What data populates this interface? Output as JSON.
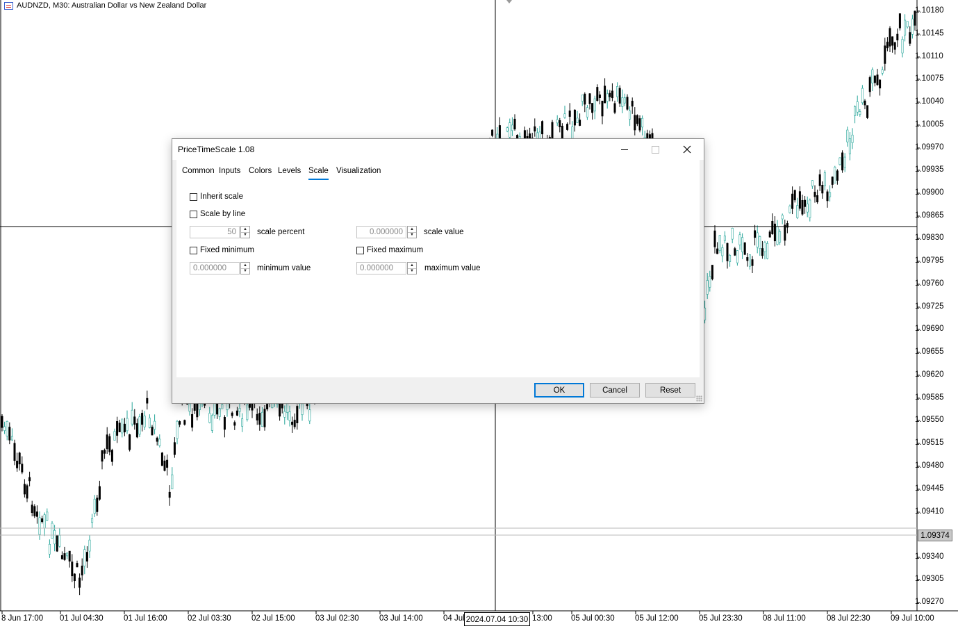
{
  "chart": {
    "title": "AUDNZD, M30:  Australian Dollar vs New Zealand Dollar",
    "price_labels": [
      "1.10180",
      "1.10145",
      "1.10110",
      "1.10075",
      "1.10040",
      "1.10005",
      "1.09970",
      "1.09935",
      "1.09900",
      "1.09865",
      "1.09830",
      "1.09795",
      "1.09760",
      "1.09725",
      "1.09690",
      "1.09655",
      "1.09620",
      "1.09585",
      "1.09550",
      "1.09515",
      "1.09480",
      "1.09445",
      "1.09410",
      "1.09340",
      "1.09305",
      "1.09270"
    ],
    "current_price": "1.09374",
    "time_labels": [
      "8 Jun 17:00",
      "01 Jul 04:30",
      "01 Jul 16:00",
      "02 Jul 03:30",
      "02 Jul 15:00",
      "03 Jul 02:30",
      "03 Jul 14:00",
      "04 Jul",
      "13:00",
      "05 Jul 00:30",
      "05 Jul 12:00",
      "05 Jul 23:30",
      "08 Jul 11:00",
      "08 Jul 22:30",
      "09 Jul 10:00"
    ],
    "crosshair_time": "2024.07.04 10:30",
    "colors": {
      "bull": "#26a69a",
      "bear": "#000000",
      "grid": "#000000"
    }
  },
  "dialog": {
    "title": "PriceTimeScale 1.08",
    "tabs": [
      "Common",
      "Inputs",
      "Colors",
      "Levels",
      "Scale",
      "Visualization"
    ],
    "active_tab": "Scale",
    "inherit_scale_label": "Inherit scale",
    "scale_by_line_label": "Scale by line",
    "scale_percent_value": "50",
    "scale_percent_label": "scale percent",
    "scale_value_value": "0.000000",
    "scale_value_label": "scale value",
    "fixed_minimum_label": "Fixed minimum",
    "fixed_maximum_label": "Fixed maximum",
    "minimum_value_value": "0.000000",
    "minimum_value_label": "minimum value",
    "maximum_value_value": "0.000000",
    "maximum_value_label": "maximum value",
    "ok_label": "OK",
    "cancel_label": "Cancel",
    "reset_label": "Reset",
    "accent_color": "#0078d7"
  }
}
